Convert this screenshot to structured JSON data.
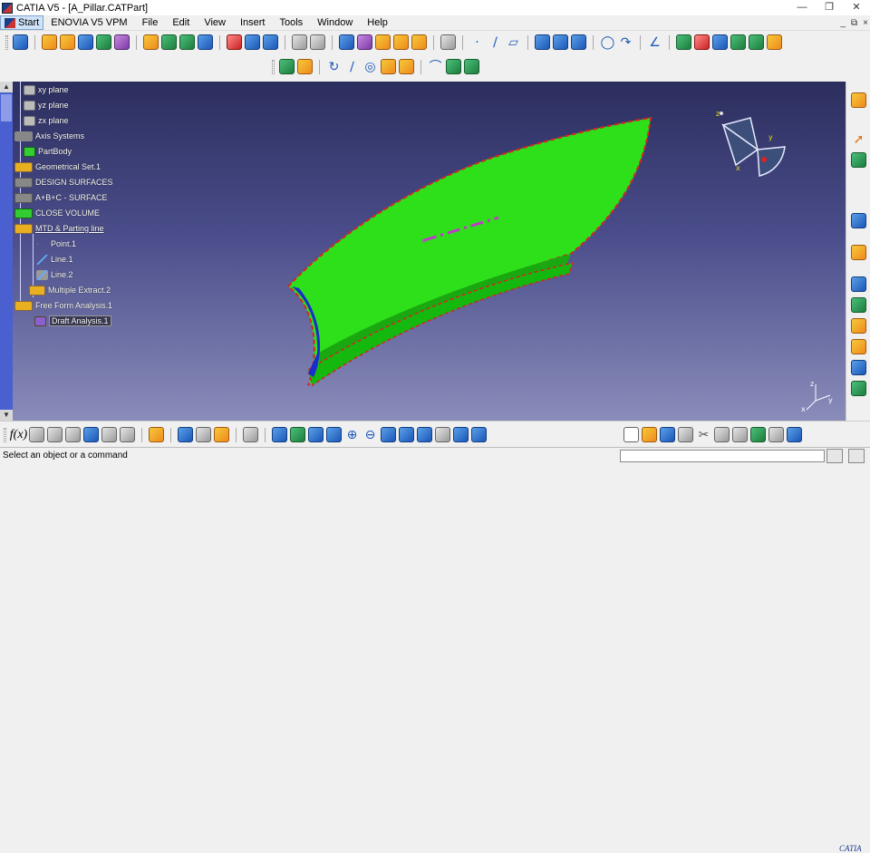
{
  "window": {
    "title": "CATIA V5 - [A_Pillar.CATPart]",
    "min_label": "—",
    "max_label": "❐",
    "close_label": "✕"
  },
  "menu": {
    "items": [
      "Start",
      "ENOVIA V5 VPM",
      "File",
      "Edit",
      "View",
      "Insert",
      "Tools",
      "Window",
      "Help"
    ],
    "doc_controls": [
      "_",
      "⧉",
      "×"
    ]
  },
  "tree": {
    "nodes": [
      {
        "label": "xy plane",
        "icon": "plane-icon"
      },
      {
        "label": "yz plane",
        "icon": "plane-icon"
      },
      {
        "label": "zx plane",
        "icon": "plane-icon"
      },
      {
        "label": "Axis Systems",
        "icon": "axis-system-icon"
      },
      {
        "label": "PartBody",
        "icon": "part-body-icon"
      },
      {
        "label": "Geometrical Set.1",
        "icon": "geometrical-set-icon"
      },
      {
        "label": "DESIGN SURFACES",
        "icon": "geometrical-set-icon"
      },
      {
        "label": "A+B+C - SURFACE",
        "icon": "geometrical-set-icon"
      },
      {
        "label": "CLOSE VOLUME",
        "icon": "part-body-icon"
      },
      {
        "label": "MTD & Parting line",
        "icon": "geometrical-set-icon"
      },
      {
        "label": "Point.1",
        "icon": "point-icon"
      },
      {
        "label": "Line.1",
        "icon": "line-icon"
      },
      {
        "label": "Line.2",
        "icon": "line-icon"
      },
      {
        "label": "Multiple Extract.2",
        "icon": "extract-icon"
      },
      {
        "label": "Free Form Analysis.1",
        "icon": "analysis-icon"
      },
      {
        "label": "Draft Analysis.1",
        "icon": "draft-analysis-icon"
      }
    ]
  },
  "viewport": {
    "background_top": "#2c2e5e",
    "background_bottom": "#8a8cba",
    "surface_color": "#22ee11",
    "edge_color": "#dd2222",
    "compass_labels": {
      "x": "x",
      "y": "y",
      "z": "z"
    },
    "axes_labels": {
      "x": "x",
      "y": "y",
      "z": "z"
    }
  },
  "status": {
    "message": "Select an object or a command"
  },
  "branding": {
    "logo": "CATIA"
  }
}
